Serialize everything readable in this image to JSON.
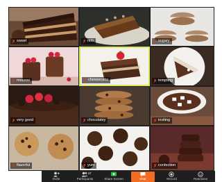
{
  "participants": [
    {
      "name": "sweet"
    },
    {
      "name": "rich"
    },
    {
      "name": "sugary"
    },
    {
      "name": "mousse"
    },
    {
      "name": "cheesecake"
    },
    {
      "name": "tempting"
    },
    {
      "name": "very good"
    },
    {
      "name": "chocolatey"
    },
    {
      "name": "inviting"
    },
    {
      "name": "flavorful"
    },
    {
      "name": "yum"
    },
    {
      "name": "confection"
    }
  ],
  "toolbar": {
    "invite": "Invite",
    "participants": "Participants",
    "participants_count": "47",
    "share_screen": "Share Screen",
    "chat": "Chat",
    "record": "Record",
    "reactions": "Reactions"
  },
  "colors": {
    "active_border": "#d8e85a",
    "toolbar_bg": "#1f1f1f",
    "chat_accent": "#f26d21",
    "share_green": "#2db84d"
  }
}
